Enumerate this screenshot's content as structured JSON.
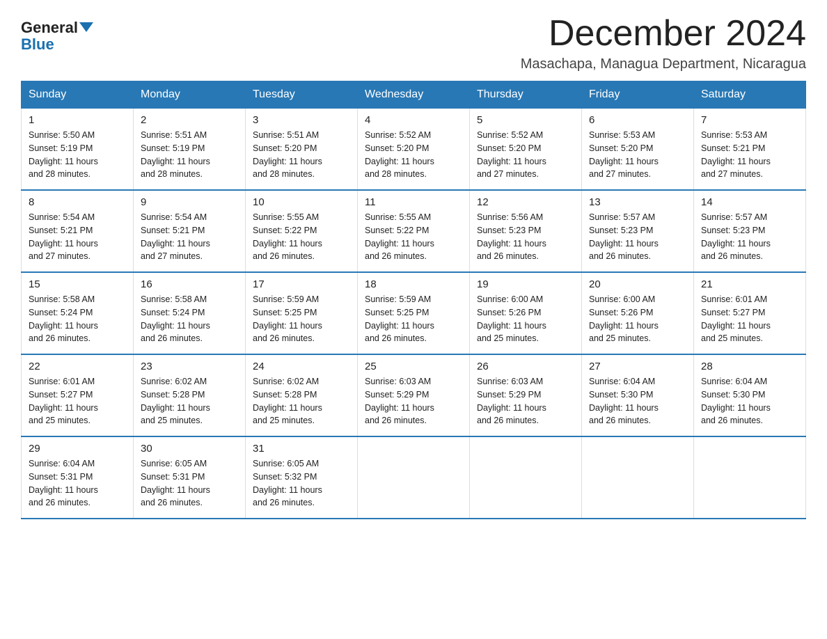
{
  "logo": {
    "text_general": "General",
    "text_blue": "Blue"
  },
  "header": {
    "title": "December 2024",
    "subtitle": "Masachapa, Managua Department, Nicaragua"
  },
  "days_of_week": [
    "Sunday",
    "Monday",
    "Tuesday",
    "Wednesday",
    "Thursday",
    "Friday",
    "Saturday"
  ],
  "weeks": [
    [
      {
        "day": "1",
        "sunrise": "5:50 AM",
        "sunset": "5:19 PM",
        "daylight": "11 hours and 28 minutes."
      },
      {
        "day": "2",
        "sunrise": "5:51 AM",
        "sunset": "5:19 PM",
        "daylight": "11 hours and 28 minutes."
      },
      {
        "day": "3",
        "sunrise": "5:51 AM",
        "sunset": "5:20 PM",
        "daylight": "11 hours and 28 minutes."
      },
      {
        "day": "4",
        "sunrise": "5:52 AM",
        "sunset": "5:20 PM",
        "daylight": "11 hours and 28 minutes."
      },
      {
        "day": "5",
        "sunrise": "5:52 AM",
        "sunset": "5:20 PM",
        "daylight": "11 hours and 27 minutes."
      },
      {
        "day": "6",
        "sunrise": "5:53 AM",
        "sunset": "5:20 PM",
        "daylight": "11 hours and 27 minutes."
      },
      {
        "day": "7",
        "sunrise": "5:53 AM",
        "sunset": "5:21 PM",
        "daylight": "11 hours and 27 minutes."
      }
    ],
    [
      {
        "day": "8",
        "sunrise": "5:54 AM",
        "sunset": "5:21 PM",
        "daylight": "11 hours and 27 minutes."
      },
      {
        "day": "9",
        "sunrise": "5:54 AM",
        "sunset": "5:21 PM",
        "daylight": "11 hours and 27 minutes."
      },
      {
        "day": "10",
        "sunrise": "5:55 AM",
        "sunset": "5:22 PM",
        "daylight": "11 hours and 26 minutes."
      },
      {
        "day": "11",
        "sunrise": "5:55 AM",
        "sunset": "5:22 PM",
        "daylight": "11 hours and 26 minutes."
      },
      {
        "day": "12",
        "sunrise": "5:56 AM",
        "sunset": "5:23 PM",
        "daylight": "11 hours and 26 minutes."
      },
      {
        "day": "13",
        "sunrise": "5:57 AM",
        "sunset": "5:23 PM",
        "daylight": "11 hours and 26 minutes."
      },
      {
        "day": "14",
        "sunrise": "5:57 AM",
        "sunset": "5:23 PM",
        "daylight": "11 hours and 26 minutes."
      }
    ],
    [
      {
        "day": "15",
        "sunrise": "5:58 AM",
        "sunset": "5:24 PM",
        "daylight": "11 hours and 26 minutes."
      },
      {
        "day": "16",
        "sunrise": "5:58 AM",
        "sunset": "5:24 PM",
        "daylight": "11 hours and 26 minutes."
      },
      {
        "day": "17",
        "sunrise": "5:59 AM",
        "sunset": "5:25 PM",
        "daylight": "11 hours and 26 minutes."
      },
      {
        "day": "18",
        "sunrise": "5:59 AM",
        "sunset": "5:25 PM",
        "daylight": "11 hours and 26 minutes."
      },
      {
        "day": "19",
        "sunrise": "6:00 AM",
        "sunset": "5:26 PM",
        "daylight": "11 hours and 25 minutes."
      },
      {
        "day": "20",
        "sunrise": "6:00 AM",
        "sunset": "5:26 PM",
        "daylight": "11 hours and 25 minutes."
      },
      {
        "day": "21",
        "sunrise": "6:01 AM",
        "sunset": "5:27 PM",
        "daylight": "11 hours and 25 minutes."
      }
    ],
    [
      {
        "day": "22",
        "sunrise": "6:01 AM",
        "sunset": "5:27 PM",
        "daylight": "11 hours and 25 minutes."
      },
      {
        "day": "23",
        "sunrise": "6:02 AM",
        "sunset": "5:28 PM",
        "daylight": "11 hours and 25 minutes."
      },
      {
        "day": "24",
        "sunrise": "6:02 AM",
        "sunset": "5:28 PM",
        "daylight": "11 hours and 25 minutes."
      },
      {
        "day": "25",
        "sunrise": "6:03 AM",
        "sunset": "5:29 PM",
        "daylight": "11 hours and 26 minutes."
      },
      {
        "day": "26",
        "sunrise": "6:03 AM",
        "sunset": "5:29 PM",
        "daylight": "11 hours and 26 minutes."
      },
      {
        "day": "27",
        "sunrise": "6:04 AM",
        "sunset": "5:30 PM",
        "daylight": "11 hours and 26 minutes."
      },
      {
        "day": "28",
        "sunrise": "6:04 AM",
        "sunset": "5:30 PM",
        "daylight": "11 hours and 26 minutes."
      }
    ],
    [
      {
        "day": "29",
        "sunrise": "6:04 AM",
        "sunset": "5:31 PM",
        "daylight": "11 hours and 26 minutes."
      },
      {
        "day": "30",
        "sunrise": "6:05 AM",
        "sunset": "5:31 PM",
        "daylight": "11 hours and 26 minutes."
      },
      {
        "day": "31",
        "sunrise": "6:05 AM",
        "sunset": "5:32 PM",
        "daylight": "11 hours and 26 minutes."
      },
      null,
      null,
      null,
      null
    ]
  ],
  "labels": {
    "sunrise": "Sunrise:",
    "sunset": "Sunset:",
    "daylight": "Daylight:"
  }
}
